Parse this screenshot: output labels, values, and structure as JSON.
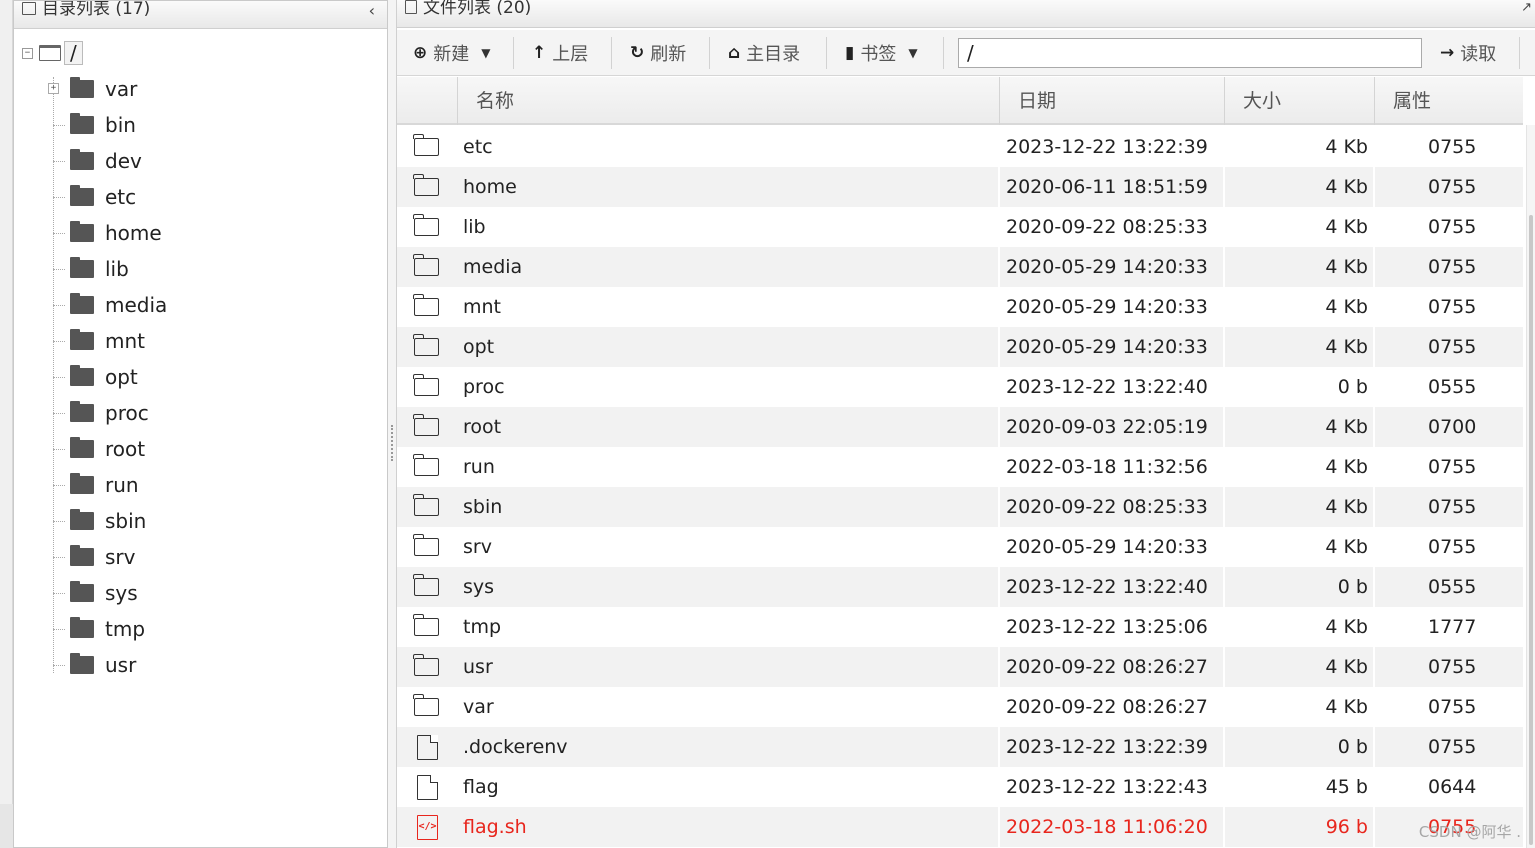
{
  "left_panel": {
    "title": "目录列表 (17)",
    "root": {
      "toggle": "−",
      "label": "/"
    },
    "items": [
      {
        "label": "var",
        "toggle": "+"
      },
      {
        "label": "bin"
      },
      {
        "label": "dev"
      },
      {
        "label": "etc"
      },
      {
        "label": "home"
      },
      {
        "label": "lib"
      },
      {
        "label": "media"
      },
      {
        "label": "mnt"
      },
      {
        "label": "opt"
      },
      {
        "label": "proc"
      },
      {
        "label": "root"
      },
      {
        "label": "run"
      },
      {
        "label": "sbin"
      },
      {
        "label": "srv"
      },
      {
        "label": "sys"
      },
      {
        "label": "tmp"
      },
      {
        "label": "usr"
      }
    ]
  },
  "right_panel": {
    "title": "文件列表 (20)",
    "toolbar": {
      "new_label": "新建",
      "up_label": "上层",
      "refresh_label": "刷新",
      "home_label": "主目录",
      "bookmark_label": "书签",
      "path_value": "/",
      "read_label": "读取"
    },
    "columns": {
      "name": "名称",
      "date": "日期",
      "size": "大小",
      "attr": "属性"
    },
    "rows": [
      {
        "type": "folder",
        "name": "etc",
        "date": "2023-12-22 13:22:39",
        "size": "4 Kb",
        "attr": "0755"
      },
      {
        "type": "folder",
        "name": "home",
        "date": "2020-06-11 18:51:59",
        "size": "4 Kb",
        "attr": "0755"
      },
      {
        "type": "folder",
        "name": "lib",
        "date": "2020-09-22 08:25:33",
        "size": "4 Kb",
        "attr": "0755"
      },
      {
        "type": "folder",
        "name": "media",
        "date": "2020-05-29 14:20:33",
        "size": "4 Kb",
        "attr": "0755"
      },
      {
        "type": "folder",
        "name": "mnt",
        "date": "2020-05-29 14:20:33",
        "size": "4 Kb",
        "attr": "0755"
      },
      {
        "type": "folder",
        "name": "opt",
        "date": "2020-05-29 14:20:33",
        "size": "4 Kb",
        "attr": "0755"
      },
      {
        "type": "folder",
        "name": "proc",
        "date": "2023-12-22 13:22:40",
        "size": "0 b",
        "attr": "0555"
      },
      {
        "type": "folder",
        "name": "root",
        "date": "2020-09-03 22:05:19",
        "size": "4 Kb",
        "attr": "0700"
      },
      {
        "type": "folder",
        "name": "run",
        "date": "2022-03-18 11:32:56",
        "size": "4 Kb",
        "attr": "0755"
      },
      {
        "type": "folder",
        "name": "sbin",
        "date": "2020-09-22 08:25:33",
        "size": "4 Kb",
        "attr": "0755"
      },
      {
        "type": "folder",
        "name": "srv",
        "date": "2020-05-29 14:20:33",
        "size": "4 Kb",
        "attr": "0755"
      },
      {
        "type": "folder",
        "name": "sys",
        "date": "2023-12-22 13:22:40",
        "size": "0 b",
        "attr": "0555"
      },
      {
        "type": "folder",
        "name": "tmp",
        "date": "2023-12-22 13:25:06",
        "size": "4 Kb",
        "attr": "1777"
      },
      {
        "type": "folder",
        "name": "usr",
        "date": "2020-09-22 08:26:27",
        "size": "4 Kb",
        "attr": "0755"
      },
      {
        "type": "folder",
        "name": "var",
        "date": "2020-09-22 08:26:27",
        "size": "4 Kb",
        "attr": "0755"
      },
      {
        "type": "file",
        "name": ".dockerenv",
        "date": "2023-12-22 13:22:39",
        "size": "0 b",
        "attr": "0755"
      },
      {
        "type": "file",
        "name": "flag",
        "date": "2023-12-22 13:22:43",
        "size": "45 b",
        "attr": "0644"
      },
      {
        "type": "script",
        "name": "flag.sh",
        "date": "2022-03-18 11:06:20",
        "size": "96 b",
        "attr": "0755",
        "highlight": "#e8261d"
      }
    ]
  },
  "watermark": "CSDN @阿华 ."
}
